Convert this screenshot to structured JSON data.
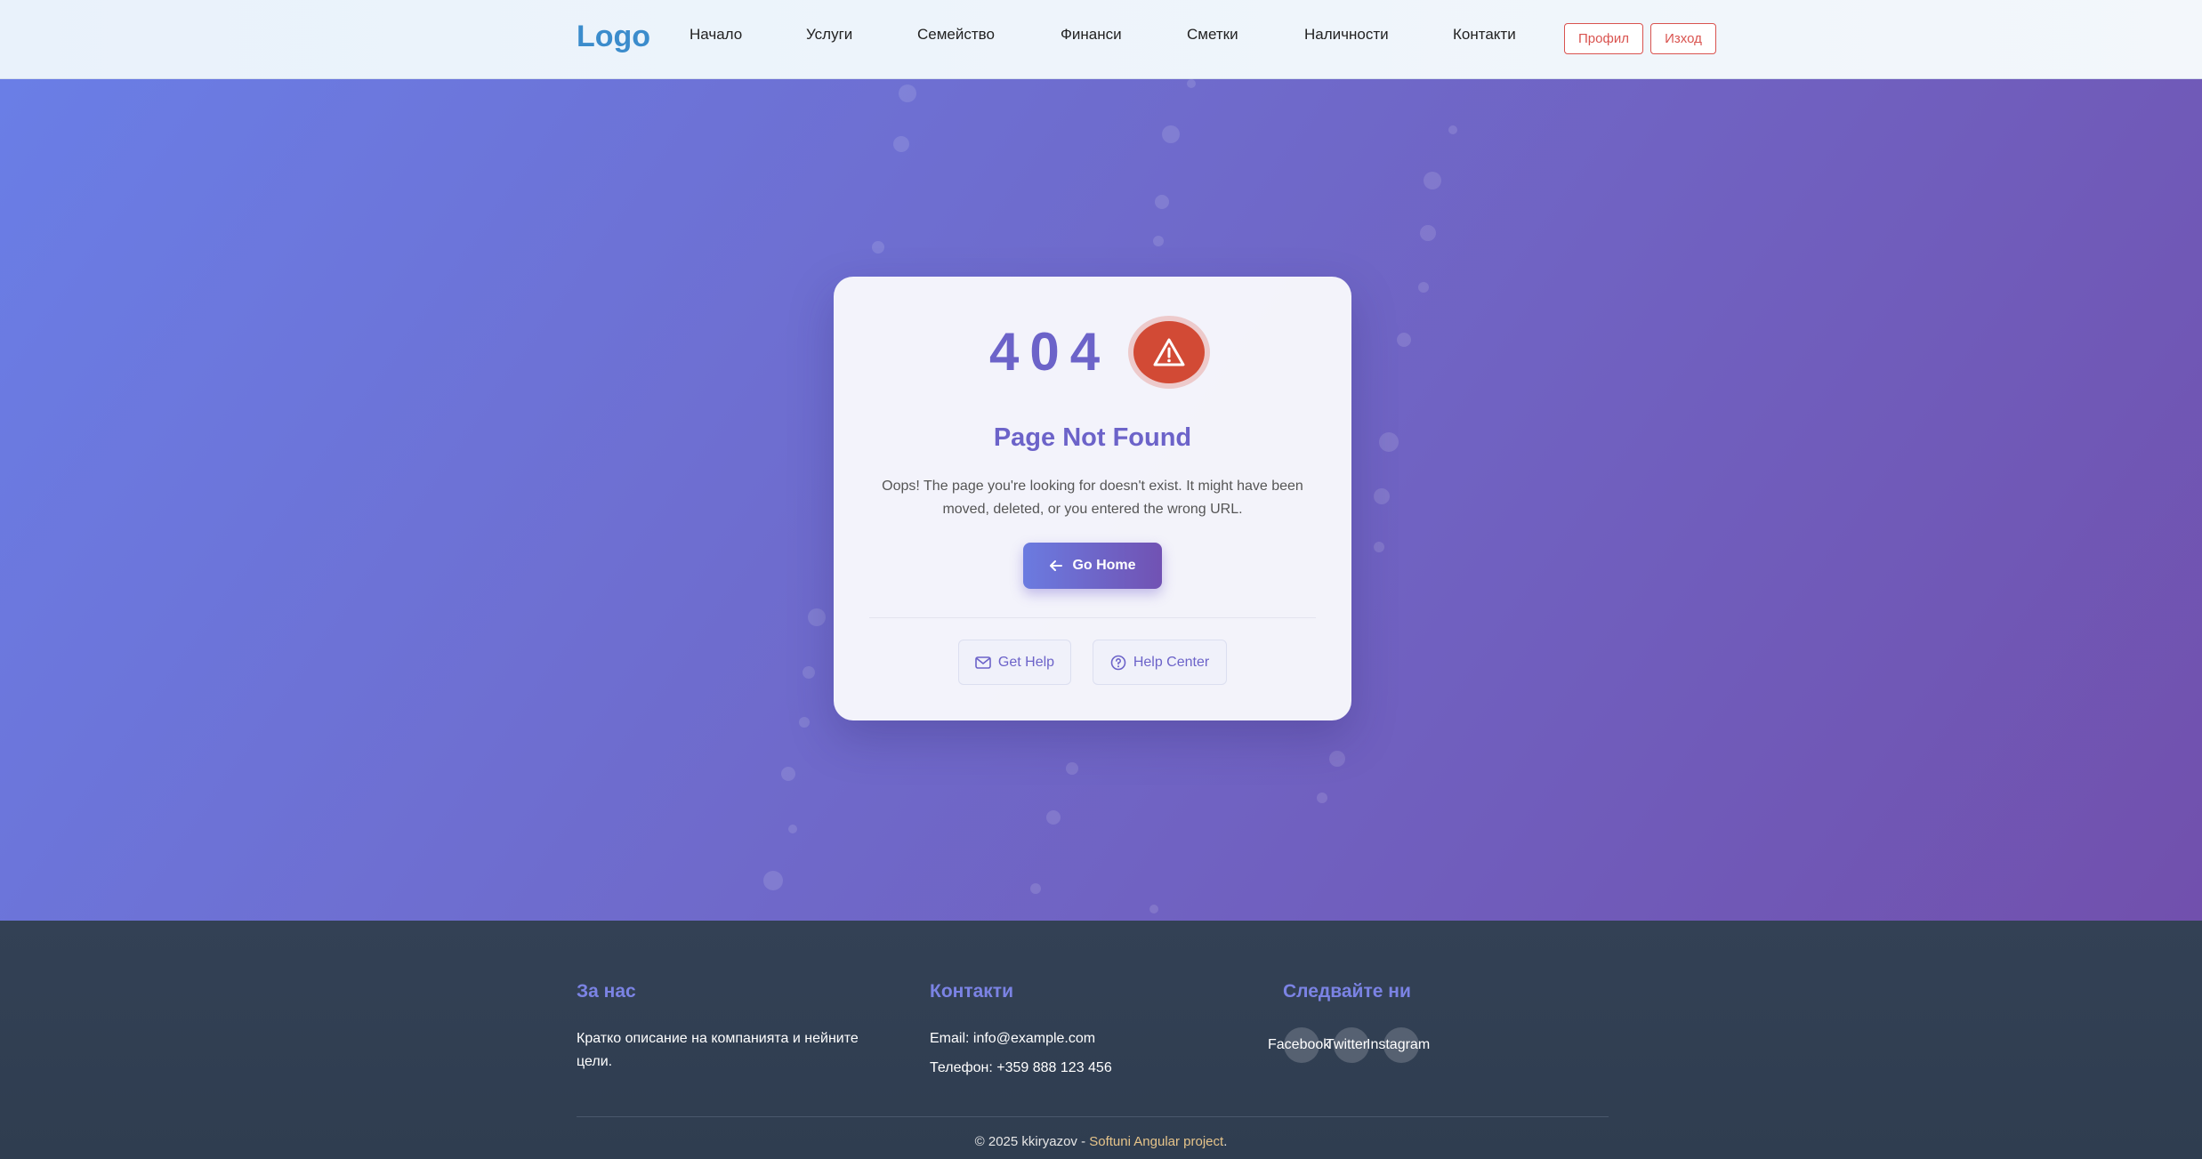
{
  "header": {
    "logo": "Logo",
    "nav": [
      "Начало",
      "Услуги",
      "Семейство",
      "Финанси",
      "Сметки",
      "Наличности",
      "Контакти"
    ],
    "profile_button": "Профил",
    "logout_button": "Изход"
  },
  "error": {
    "code": "404",
    "icon": "warning-triangle-icon",
    "title": "Page Not Found",
    "message": "Oops! The page you're looking for doesn't exist. It might have been moved, deleted, or you entered the wrong URL.",
    "go_home": "Go Home",
    "get_help": "Get Help",
    "help_center": "Help Center"
  },
  "footer": {
    "about_title": "За нас",
    "about_text": "Кратко описание на компанията и нейните цели.",
    "contacts_title": "Контакти",
    "email": "Email: info@example.com",
    "phone": "Телефон: +359 888 123 456",
    "follow_title": "Следвайте ни",
    "social": [
      "Facebook",
      "Twitter",
      "Instagram"
    ],
    "copyright_prefix": "© 2025 kkiryazov - ",
    "copyright_link": "Softuni Angular project",
    "copyright_suffix": "."
  },
  "colors": {
    "accent": "#6c63c9",
    "danger": "#d24a35",
    "logo": "#3b8ccc",
    "footer_bg": "#334155"
  }
}
